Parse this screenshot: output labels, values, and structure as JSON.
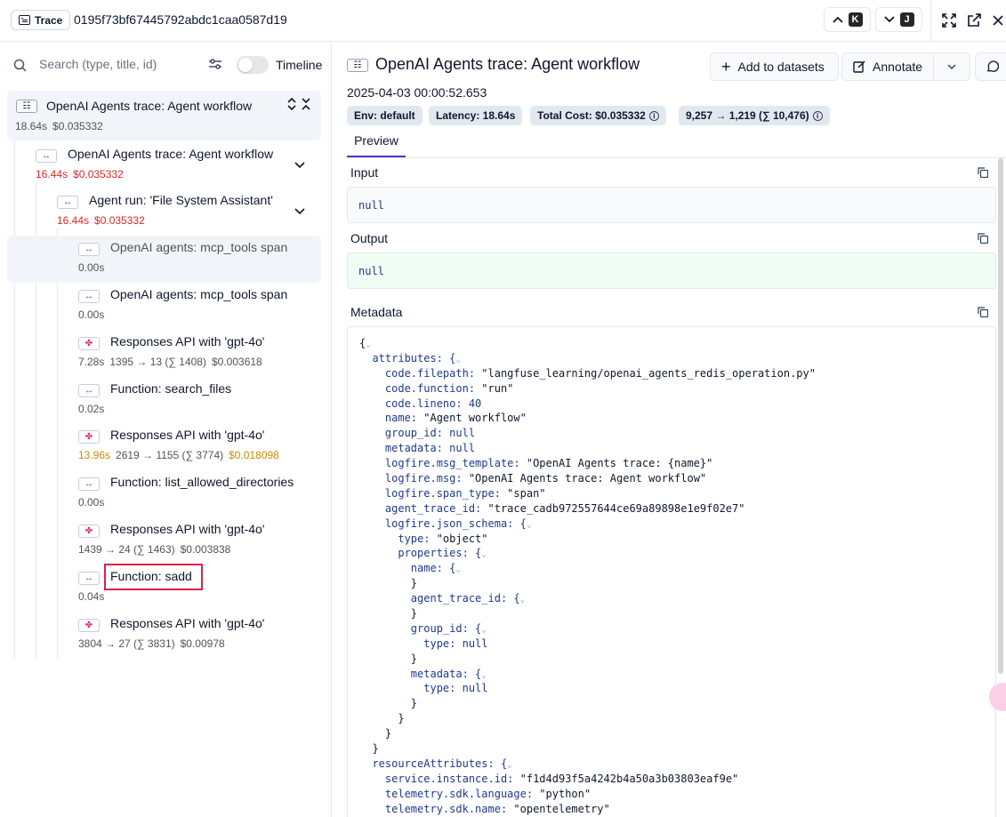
{
  "topbar": {
    "badge_label": "Trace",
    "trace_id": "0195f73bf67445792abdc1caa0587d19",
    "prev_key": "K",
    "next_key": "J"
  },
  "left": {
    "search_placeholder": "Search (type, title, id)",
    "timeline_label": "Timeline",
    "root": {
      "title": "OpenAI Agents trace: Agent workflow",
      "latency": "18.64s",
      "cost": "$0.035332"
    },
    "nodes": [
      {
        "title": "OpenAI Agents trace: Agent workflow",
        "latency": "16.44s",
        "cost": "$0.035332"
      },
      {
        "title": "Agent run: 'File System Assistant'",
        "latency": "16.44s",
        "cost": "$0.035332"
      },
      {
        "title": "OpenAI agents: mcp_tools span",
        "latency": "0.00s"
      },
      {
        "title": "OpenAI agents: mcp_tools span",
        "latency": "0.00s"
      },
      {
        "title": "Responses API with 'gpt-4o'",
        "latency": "7.28s",
        "tokens": "1395 → 13 (∑ 1408)",
        "cost": "$0.003618"
      },
      {
        "title": "Function: search_files",
        "latency": "0.02s"
      },
      {
        "title": "Responses API with 'gpt-4o'",
        "latency": "13.96s",
        "tokens": "2619 → 1155 (∑ 3774)",
        "cost": "$0.018098"
      },
      {
        "title": "Function: list_allowed_directories",
        "latency": "0.00s"
      },
      {
        "title": "Responses API with 'gpt-4o'",
        "latency": "1439 → 24 (∑ 1463)",
        "cost": "$0.003838"
      },
      {
        "title": "Function: sadd",
        "latency": "0.04s"
      },
      {
        "title": "Responses API with 'gpt-4o'",
        "latency": "3804 → 27 (∑ 3831)",
        "cost": "$0.00978"
      }
    ]
  },
  "detail": {
    "title": "OpenAI Agents trace: Agent workflow",
    "add_to_datasets": "Add to datasets",
    "annotate": "Annotate",
    "timestamp": "2025-04-03 00:00:52.653",
    "badges": {
      "env": "Env: default",
      "latency": "Latency: 18.64s",
      "cost": "Total Cost: $0.035332",
      "tokens": "9,257 → 1,219 (∑ 10,476)"
    },
    "tab": "Preview",
    "input_label": "Input",
    "input_value": "null",
    "output_label": "Output",
    "output_value": "null",
    "metadata_label": "Metadata",
    "metadata_lines": [
      "{",
      "  attributes: {",
      "    code.filepath: \"langfuse_learning/openai_agents_redis_operation.py\"",
      "    code.function: \"run\"",
      "    code.lineno: 40",
      "    name: \"Agent workflow\"",
      "    group_id: null",
      "    metadata: null",
      "    logfire.msg_template: \"OpenAI Agents trace: {name}\"",
      "    logfire.msg: \"OpenAI Agents trace: Agent workflow\"",
      "    logfire.span_type: \"span\"",
      "    agent_trace_id: \"trace_cadb972557644ce69a89898e1e9f02e7\"",
      "    logfire.json_schema: {",
      "      type: \"object\"",
      "      properties: {",
      "        name: {",
      "        }",
      "        agent_trace_id: {",
      "        }",
      "        group_id: {",
      "          type: null",
      "        }",
      "        metadata: {",
      "          type: null",
      "        }",
      "      }",
      "    }",
      "  }",
      "  resourceAttributes: {",
      "    service.instance.id: \"f1d4d93f5a4242b4a50a3b03803eaf9e\"",
      "    telemetry.sdk.language: \"python\"",
      "    telemetry.sdk.name: \"opentelemetry\""
    ]
  }
}
